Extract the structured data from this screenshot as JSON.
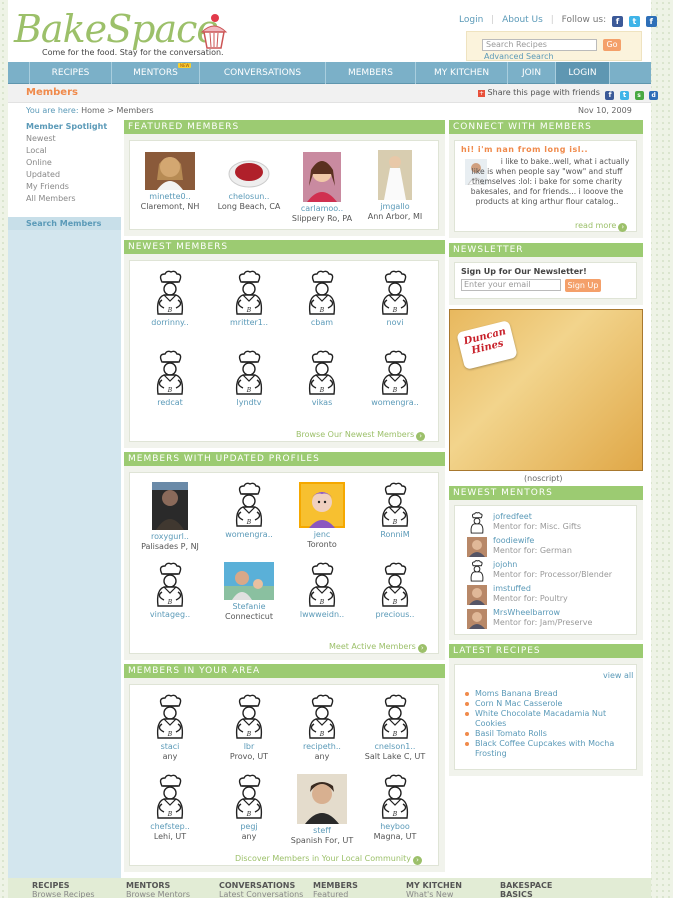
{
  "header": {
    "logo_text": "BakeSpace",
    "tagline": "Come for the food.  Stay for the conversation.",
    "top_links": [
      "Login",
      "About Us"
    ],
    "follow_label": "Follow us:",
    "search_placeholder": "Search Recipes",
    "search_button": "Go",
    "advanced_search": "Advanced Search"
  },
  "nav": {
    "items": [
      "RECIPES",
      "MENTORS",
      "CONVERSATIONS",
      "MEMBERS",
      "MY KITCHEN",
      "JOIN",
      "LOGIN"
    ],
    "new_badge": "NEW"
  },
  "page": {
    "title": "Members",
    "share": "Share this page with friends",
    "breadcrumb_label": "You are here:",
    "breadcrumb": "Home > Members",
    "date": "Nov 10, 2009"
  },
  "sidebar": {
    "heading": "Member Spotlight",
    "items": [
      "Newest",
      "Local",
      "Online",
      "Updated",
      "My Friends",
      "All Members"
    ],
    "search": "Search Members"
  },
  "featured": {
    "title": "FEATURED MEMBERS",
    "members": [
      {
        "name": "minette0..",
        "loc": "Claremont, NH"
      },
      {
        "name": "chelosun..",
        "loc": "Long Beach, CA"
      },
      {
        "name": "carlamoo..",
        "loc": "Slippery Ro, PA"
      },
      {
        "name": "jmgallo",
        "loc": "Ann Arbor, MI"
      }
    ]
  },
  "newest": {
    "title": "NEWEST MEMBERS",
    "members": [
      "dorrinny..",
      "mritter1..",
      "cbam",
      "novi",
      "redcat",
      "lyndtv",
      "vikas",
      "womengra.."
    ],
    "more": "Browse Our Newest Members"
  },
  "updated": {
    "title": "MEMBERS WITH UPDATED PROFILES",
    "members": [
      {
        "name": "roxygurl..",
        "loc": "Palisades P, NJ"
      },
      {
        "name": "womengra..",
        "loc": ""
      },
      {
        "name": "jenc",
        "loc": "Toronto"
      },
      {
        "name": "RonniM",
        "loc": ""
      },
      {
        "name": "vintageg..",
        "loc": ""
      },
      {
        "name": "Stefanie",
        "loc": "Connecticut"
      },
      {
        "name": "lwwweidn..",
        "loc": ""
      },
      {
        "name": "precious..",
        "loc": ""
      }
    ],
    "more": "Meet Active Members"
  },
  "area": {
    "title": "MEMBERS IN YOUR AREA",
    "members": [
      {
        "name": "staci",
        "loc": "any"
      },
      {
        "name": "lbr",
        "loc": "Provo, UT"
      },
      {
        "name": "recipeth..",
        "loc": "any"
      },
      {
        "name": "cnelson1..",
        "loc": "Salt Lake C, UT"
      },
      {
        "name": "chefstep..",
        "loc": "Lehi, UT"
      },
      {
        "name": "pegj",
        "loc": "any"
      },
      {
        "name": "steff",
        "loc": "Spanish For, UT"
      },
      {
        "name": "heyboo",
        "loc": "Magna, UT"
      }
    ],
    "more": "Discover Members in Your Local Community"
  },
  "connect": {
    "title": "CONNECT WITH MEMBERS",
    "post_title": "hi! i'm nan from long isl..",
    "post_text": "i like to bake..well, what i actually like is when people say \"wow\" and stuff themselves :lol: i bake for some charity bakesales, and for friends... i looove the products at king arthur flour catalog..",
    "read_more": "read more"
  },
  "newsletter": {
    "title": "NEWSLETTER",
    "heading": "Sign Up for Our Newsletter!",
    "placeholder": "Enter your email",
    "button": "Sign Up"
  },
  "ad": {
    "brand": "Duncan Hines",
    "noscript": "(noscript)"
  },
  "mentors": {
    "title": "NEWEST MENTORS",
    "items": [
      {
        "name": "jofredfeet",
        "sub": "Mentor for: Misc. Gifts"
      },
      {
        "name": "foodiewife",
        "sub": "Mentor for: German"
      },
      {
        "name": "jojohn",
        "sub": "Mentor for: Processor/Blender"
      },
      {
        "name": "imstuffed",
        "sub": "Mentor for: Poultry"
      },
      {
        "name": "MrsWheelbarrow",
        "sub": "Mentor for: Jam/Preserve"
      }
    ]
  },
  "recipes": {
    "title": "LATEST RECIPES",
    "view_all": "view all",
    "items": [
      "Moms Banana Bread",
      "Corn N Mac Casserole",
      "White Chocolate Macadamia Nut Cookies",
      "Basil Tomato Rolls",
      "Black Coffee Cupcakes with Mocha Frosting"
    ]
  },
  "footer": {
    "cols": [
      {
        "h": "RECIPES",
        "s": "Browse Recipes"
      },
      {
        "h": "MENTORS",
        "s": "Browse Mentors"
      },
      {
        "h": "CONVERSATIONS",
        "s": "Latest Conversations"
      },
      {
        "h": "MEMBERS",
        "s": "Featured"
      },
      {
        "h": "MY KITCHEN",
        "s": "What's New"
      },
      {
        "h": "BAKESPACE",
        "s": "BASICS"
      }
    ]
  },
  "colors": {
    "green": "#9ccb72",
    "blue_nav": "#7bb0c8",
    "orange": "#f08a4b",
    "link": "#5b9ab8"
  }
}
